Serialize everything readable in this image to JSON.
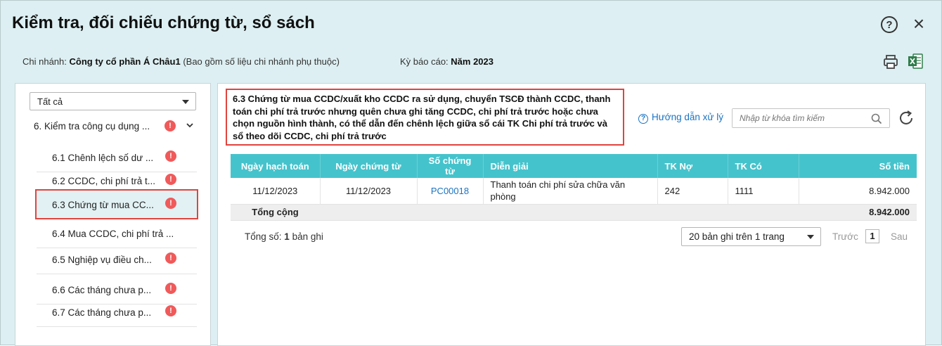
{
  "window": {
    "title": "Kiểm tra, đối chiếu chứng từ, sổ sách",
    "help_symbol": "?",
    "close_symbol": "×"
  },
  "meta": {
    "branch_label": "Chi nhánh:",
    "branch_value": "Công ty cổ phần Á Châu1",
    "branch_note": "(Bao gồm số liệu chi nhánh phụ thuộc)",
    "period_label": "Kỳ báo cáo:",
    "period_value": "Năm 2023"
  },
  "sidebar": {
    "filter_value": "Tất cả",
    "group_label": "6. Kiểm tra công cụ dụng ...",
    "badge": "!",
    "items": [
      {
        "label": "6.1 Chênh lệch số dư ..."
      },
      {
        "label": "6.2 CCDC, chi phí trả t..."
      },
      {
        "label": "6.3 Chứng từ mua CC..."
      },
      {
        "label": "6.4 Mua CCDC, chi phí trả ..."
      },
      {
        "label": "6.5 Nghiệp vụ điều ch..."
      },
      {
        "label": "6.6 Các tháng chưa p..."
      },
      {
        "label": "6.7 Các tháng chưa p..."
      }
    ]
  },
  "main": {
    "description": "6.3 Chứng từ mua CCDC/xuất kho CCDC ra sử dụng, chuyển TSCĐ thành CCDC, thanh toán chi phí trả trước nhưng quên chưa ghi tăng CCDC, chi phí trả trước hoặc chưa chọn nguồn hình thành, có thể dẫn đến chênh lệch giữa sổ cái TK Chi phí trả trước và sổ theo dõi CCDC, chi phí trả trước",
    "guide_label": "Hướng dẫn xử lý",
    "search_placeholder": "Nhập từ khóa tìm kiếm",
    "table": {
      "headers": [
        "Ngày hạch toán",
        "Ngày chứng từ",
        "Số chứng từ",
        "Diễn giải",
        "TK Nợ",
        "TK Có",
        "Số tiền"
      ],
      "rows": [
        [
          "11/12/2023",
          "11/12/2023",
          "PC00018",
          "Thanh toán chi phí sửa chữa văn phòng",
          "242",
          "1111",
          "8.942.000"
        ]
      ],
      "total_label": "Tổng cộng",
      "total_value": "8.942.000"
    },
    "footer": {
      "count_label": "Tổng số:",
      "count_value": "1",
      "count_unit": "bản ghi",
      "page_size": "20 bản ghi trên 1 trang",
      "prev_label": "Trước",
      "page": "1",
      "next_label": "Sau"
    }
  }
}
